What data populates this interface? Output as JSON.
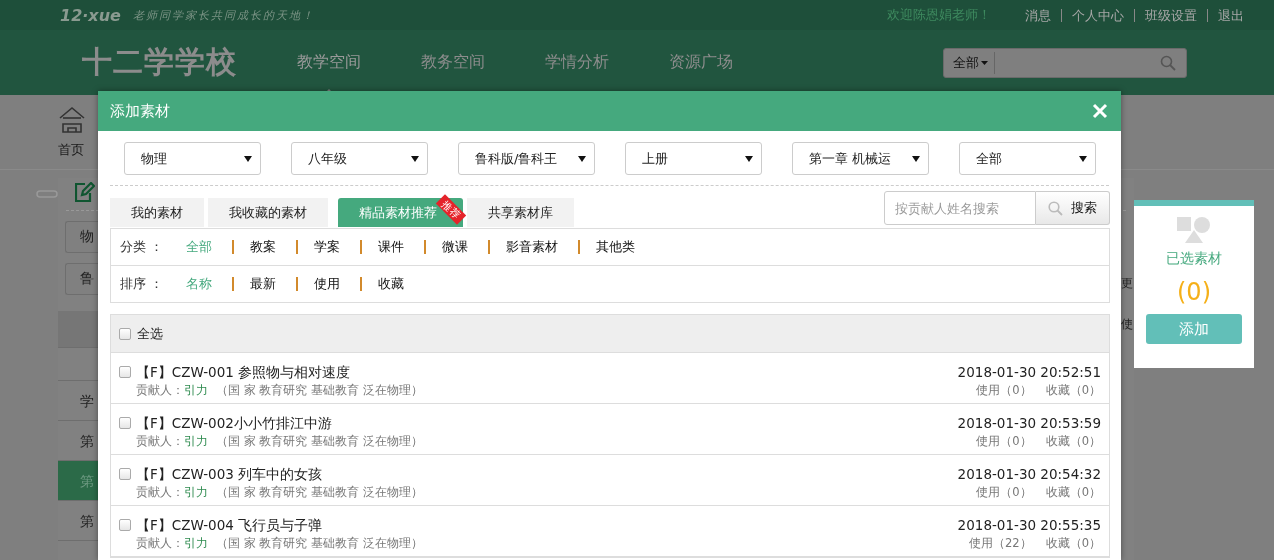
{
  "topbar": {
    "logo": "12·xue",
    "slogan": "老师同学家长共同成长的天地！",
    "welcome": "欢迎陈恩娟老师！",
    "links": [
      "消息",
      "个人中心",
      "班级设置",
      "退出"
    ]
  },
  "header": {
    "school": "十二学学校",
    "nav": [
      {
        "label": "教学空间",
        "selected": true
      },
      {
        "label": "教务空间",
        "selected": false
      },
      {
        "label": "学情分析",
        "selected": false
      },
      {
        "label": "资源广场",
        "selected": false
      }
    ],
    "search": {
      "scope": "全部"
    }
  },
  "page": {
    "home": "首页",
    "filters": [
      "物",
      "鲁"
    ],
    "right_labels": [
      "更",
      "使"
    ],
    "list": [
      {
        "label": "学",
        "selected": false
      },
      {
        "label": "第",
        "selected": false
      },
      {
        "label": "第",
        "selected": true
      },
      {
        "label": "第",
        "selected": false
      }
    ]
  },
  "dialog": {
    "title": "添加素材",
    "selects": [
      "物理",
      "八年级",
      "鲁科版/鲁科王",
      "上册",
      "第一章 机械运",
      "全部"
    ],
    "tabs": [
      {
        "label": "我的素材",
        "selected": false
      },
      {
        "label": "我收藏的素材",
        "selected": false
      },
      {
        "label": "精品素材推荐",
        "selected": true,
        "badge": "推荐"
      },
      {
        "label": "共享素材库",
        "selected": false
      }
    ],
    "search": {
      "placeholder": "按贡献人姓名搜索",
      "button": "搜索"
    },
    "category": {
      "label": "分类 ：",
      "options": [
        {
          "label": "全部",
          "selected": true
        },
        {
          "label": "教案",
          "selected": false
        },
        {
          "label": "学案",
          "selected": false
        },
        {
          "label": "课件",
          "selected": false
        },
        {
          "label": "微课",
          "selected": false
        },
        {
          "label": "影音素材",
          "selected": false
        },
        {
          "label": "其他类",
          "selected": false
        }
      ]
    },
    "sort": {
      "label": "排序 ：",
      "options": [
        {
          "label": "名称",
          "selected": true
        },
        {
          "label": "最新",
          "selected": false
        },
        {
          "label": "使用",
          "selected": false
        },
        {
          "label": "收藏",
          "selected": false
        }
      ]
    },
    "select_all": {
      "label": "全选",
      "checked": false
    },
    "items": [
      {
        "title": "【F】CZW-001 参照物与相对速度",
        "contributor_label": "贡献人：",
        "contributor": "引力",
        "organization": "（国 家 教育研究 基础教育 泛在物理）",
        "date": "2018-01-30 20:52:51",
        "uses": "使用（0）",
        "favorites": "收藏（0）",
        "checked": false
      },
      {
        "title": "【F】CZW-002小小竹排江中游",
        "contributor_label": "贡献人：",
        "contributor": "引力",
        "organization": "（国 家 教育研究 基础教育 泛在物理）",
        "date": "2018-01-30 20:53:59",
        "uses": "使用（0）",
        "favorites": "收藏（0）",
        "checked": false
      },
      {
        "title": "【F】CZW-003 列车中的女孩",
        "contributor_label": "贡献人：",
        "contributor": "引力",
        "organization": "（国 家 教育研究 基础教育 泛在物理）",
        "date": "2018-01-30 20:54:32",
        "uses": "使用（0）",
        "favorites": "收藏（0）",
        "checked": false
      },
      {
        "title": "【F】CZW-004 飞行员与子弹",
        "contributor_label": "贡献人：",
        "contributor": "引力",
        "organization": "（国 家 教育研究 基础教育 泛在物理）",
        "date": "2018-01-30 20:55:35",
        "uses": "使用（22）",
        "favorites": "收藏（0）",
        "checked": false
      }
    ]
  },
  "selected_panel": {
    "label": "已选素材",
    "count": "(0)",
    "button": "添加"
  }
}
